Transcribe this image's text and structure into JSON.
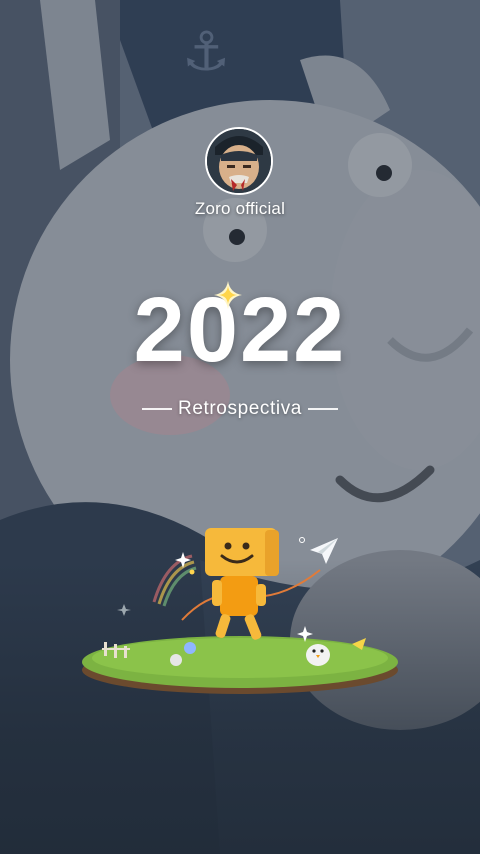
{
  "profile": {
    "username": "Zoro official",
    "avatar_icon": "profile-avatar"
  },
  "recap": {
    "year": "2022",
    "subtitle": "Retrospectiva"
  },
  "colors": {
    "text": "#ffffff",
    "character_yellow": "#f6b93b",
    "character_orange": "#f39c12",
    "grass": "#7cb342"
  },
  "icons": [
    "sparkle-icon",
    "paper-plane-icon",
    "character-illustration"
  ]
}
